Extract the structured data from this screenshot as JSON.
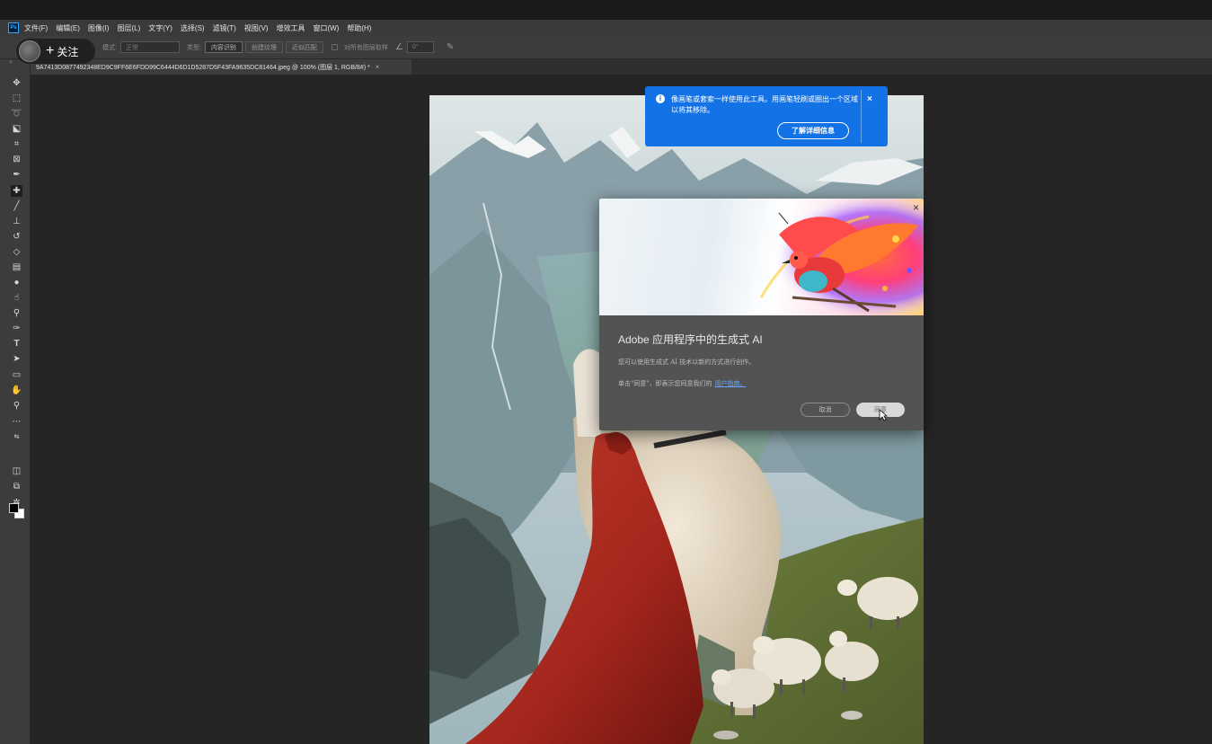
{
  "app": {
    "logo": "Ps",
    "menu": [
      "文件(F)",
      "编辑(E)",
      "图像(I)",
      "图层(L)",
      "文字(Y)",
      "选择(S)",
      "滤镜(T)",
      "视图(V)",
      "增效工具",
      "窗口(W)",
      "帮助(H)"
    ]
  },
  "overlay": {
    "follow_plus": "+",
    "follow_label": "关注"
  },
  "options": {
    "mode_label": "模式:",
    "mode_value": "正常",
    "type_label": "类型:",
    "type_buttons": [
      "内容识别",
      "创建纹理",
      "近似匹配"
    ],
    "sample_all_layers": "对所有图层取样",
    "angle_value": "0°"
  },
  "tools": [
    "move-icon",
    "marquee-icon",
    "lasso-icon",
    "object-select-icon",
    "crop-icon",
    "frame-icon",
    "eyedropper-icon",
    "spot-healing-icon",
    "brush-icon",
    "stamp-icon",
    "history-brush-icon",
    "eraser-icon",
    "gradient-icon",
    "blur-icon",
    "smudge-icon",
    "dodge-icon",
    "pen-icon",
    "type-icon",
    "path-select-icon",
    "rectangle-icon",
    "hand-icon",
    "zoom-icon",
    "more-icon"
  ],
  "document": {
    "tab_title": "9A7413D0877492348ED9C9FF6E6FDD99C6444D6D1D5287D5F43FA9635DC81464.jpeg @ 100% (图层 1, RGB/8#) *",
    "tab_close": "×"
  },
  "tip": {
    "icon": "i",
    "text": "像画笔或套索一样使用此工具。用画笔轻刷或圈出一个区域以将其移除。",
    "close": "×",
    "button": "了解详细信息"
  },
  "dialog": {
    "close": "×",
    "title": "Adobe 应用程序中的生成式 AI",
    "body": "您可以使用生成式 AI 技术以新的方式进行创作。",
    "agree_prefix": "单击\"同意\"，即表示您同意我们的",
    "agree_link": "用户指南。",
    "cancel": "取消",
    "agree": "同意"
  },
  "colors": {
    "tip_blue": "#1373e6",
    "dialog_bg": "#535353",
    "cloak_red": "#a3261c"
  }
}
